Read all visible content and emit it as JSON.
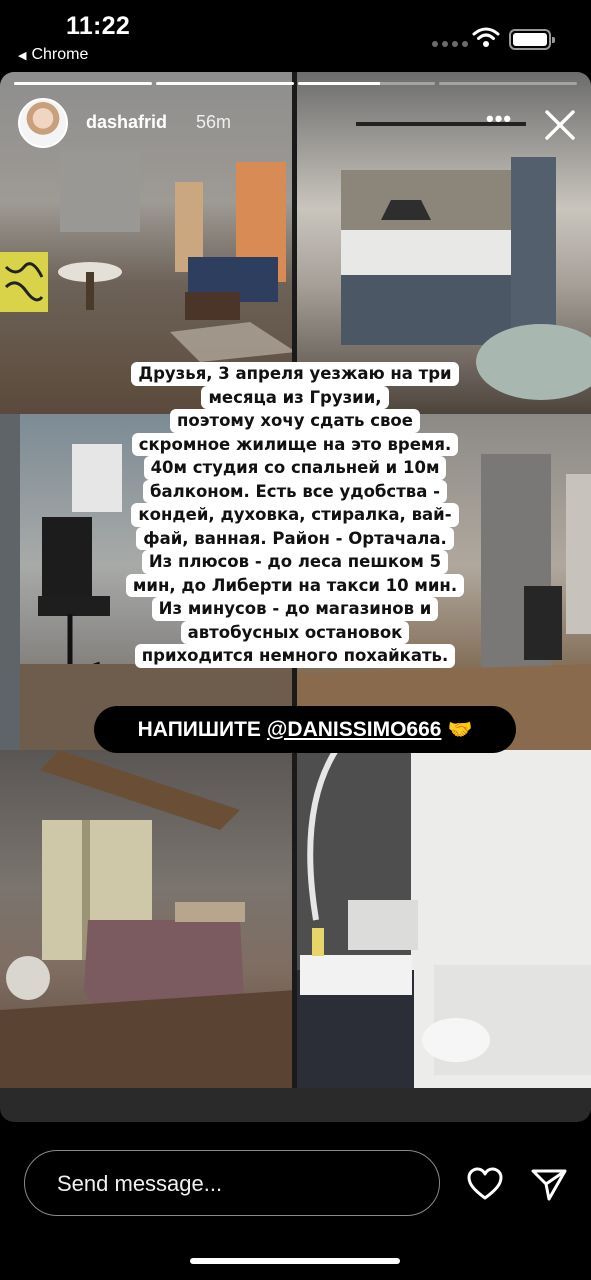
{
  "status_bar": {
    "time": "11:22",
    "back_label": "Chrome",
    "back_icon": "triangle-left-icon"
  },
  "story": {
    "username": "dashafrid",
    "posted_ago": "56m",
    "segments": {
      "total": 4,
      "active_index": 2,
      "active_progress": 0.6
    },
    "photos": [
      "living-room-photo",
      "kitchen-photo",
      "office-photo",
      "hall-photo",
      "bedroom-photo",
      "bathroom-photo"
    ],
    "caption_lines": [
      "Друзья, 3 апреля уезжаю на три",
      "месяца из Грузии,",
      "поэтому хочу сдать свое",
      "скромное жилище на это время.",
      "40м студия со спальней и 10м",
      "балконом. Есть все удобства -",
      "кондей, духовка, стиралка, вай-",
      "фай, ванная. Район - Ортачала.",
      "Из плюсов - до леса пешком 5",
      "мин, до Либерти на такси 10 мин.",
      "Из минусов - до магазинов и",
      "автобусных остановок",
      "приходится немного похайкать."
    ],
    "cta": {
      "prefix": "НАПИШИТЕ",
      "mention": "@DANISSIMO666",
      "emoji": "🤝"
    }
  },
  "bottom": {
    "message_placeholder": "Send message..."
  },
  "colors": {
    "background": "#000000",
    "caption_bg": "#ffffff",
    "caption_text": "#111111"
  }
}
